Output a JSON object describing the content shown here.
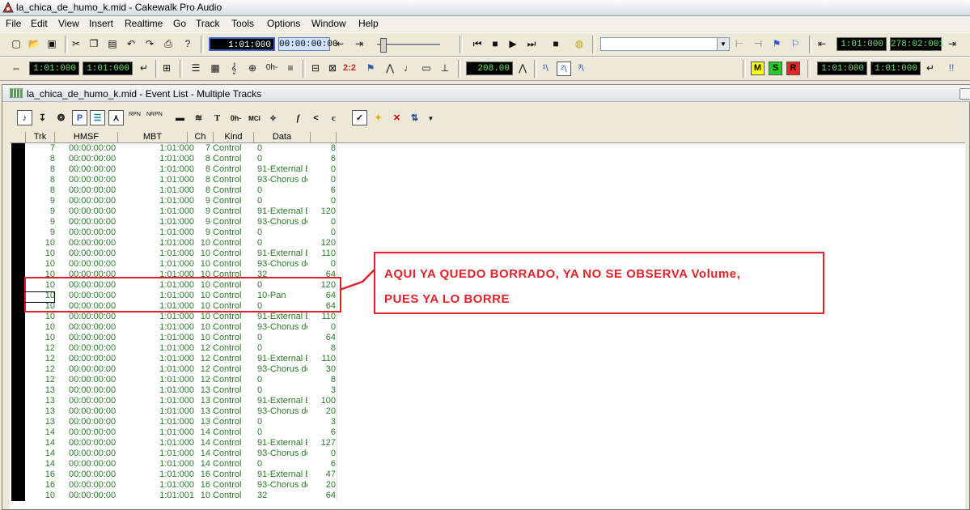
{
  "window": {
    "title": "la_chica_de_humo_k.mid - Cakewalk Pro Audio"
  },
  "menu": [
    "File",
    "Edit",
    "View",
    "Insert",
    "Realtime",
    "Go",
    "Track",
    "Tools",
    "Options",
    "Window",
    "Help"
  ],
  "toolbar1": {
    "now_time": "1:01:000",
    "smpte": "00:00:00:00",
    "from_time": "1:01:000",
    "thru_time": "278:02:001"
  },
  "toolbar2": {
    "from": "1:01:000",
    "thru": "1:01:000",
    "tempo": "208.00",
    "punch_in": "1:01:000",
    "punch_out": "1:01:000",
    "msr_m": "M",
    "msr_s": "S",
    "msr_r": "R",
    "time_sig": "0h-",
    "ratio": "2:2"
  },
  "event_list": {
    "title": "la_chica_de_humo_k.mid - Event List - Multiple Tracks",
    "toolbar": {
      "p": "P",
      "rpn": "RPN",
      "nrpn": "NRPN",
      "text": "T",
      "ch": "0h-",
      "mci": "MCI",
      "f": "f",
      "c": "c"
    },
    "columns": [
      "Trk",
      "HMSF",
      "MBT",
      "Ch",
      "Kind",
      "Data"
    ],
    "rows": [
      [
        "7",
        "00:00:00:00",
        "1:01:000",
        "7",
        "Control",
        "0",
        "8"
      ],
      [
        "8",
        "00:00:00:00",
        "1:01:000",
        "8",
        "Control",
        "0",
        "6"
      ],
      [
        "8",
        "00:00:00:00",
        "1:01:000",
        "8",
        "Control",
        "91-External E",
        "0"
      ],
      [
        "8",
        "00:00:00:00",
        "1:01:000",
        "8",
        "Control",
        "93-Chorus de",
        "0"
      ],
      [
        "8",
        "00:00:00:00",
        "1:01:000",
        "8",
        "Control",
        "0",
        "6"
      ],
      [
        "9",
        "00:00:00:00",
        "1:01:000",
        "9",
        "Control",
        "0",
        "0"
      ],
      [
        "9",
        "00:00:00:00",
        "1:01:000",
        "9",
        "Control",
        "91-External E",
        "120"
      ],
      [
        "9",
        "00:00:00:00",
        "1:01:000",
        "9",
        "Control",
        "93-Chorus de",
        "0"
      ],
      [
        "9",
        "00:00:00:00",
        "1:01:000",
        "9",
        "Control",
        "0",
        "0"
      ],
      [
        "10",
        "00:00:00:00",
        "1:01:000",
        "10",
        "Control",
        "0",
        "120"
      ],
      [
        "10",
        "00:00:00:00",
        "1:01:000",
        "10",
        "Control",
        "91-External E",
        "110"
      ],
      [
        "10",
        "00:00:00:00",
        "1:01:000",
        "10",
        "Control",
        "93-Chorus de",
        "0"
      ],
      [
        "10",
        "00:00:00:00",
        "1:01:000",
        "10",
        "Control",
        "32",
        "64"
      ],
      [
        "10",
        "00:00:00:00",
        "1:01:000",
        "10",
        "Control",
        "0",
        "120"
      ],
      [
        "10",
        "00:00:00:00",
        "1:01:000",
        "10",
        "Control",
        "10-Pan",
        "64"
      ],
      [
        "10",
        "00:00:00:00",
        "1:01:000",
        "10",
        "Control",
        "0",
        "64"
      ],
      [
        "10",
        "00:00:00:00",
        "1:01:000",
        "10",
        "Control",
        "91-External E",
        "110"
      ],
      [
        "10",
        "00:00:00:00",
        "1:01:000",
        "10",
        "Control",
        "93-Chorus de",
        "0"
      ],
      [
        "10",
        "00:00:00:00",
        "1:01:000",
        "10",
        "Control",
        "0",
        "64"
      ],
      [
        "12",
        "00:00:00:00",
        "1:01:000",
        "12",
        "Control",
        "0",
        "8"
      ],
      [
        "12",
        "00:00:00:00",
        "1:01:000",
        "12",
        "Control",
        "91-External E",
        "110"
      ],
      [
        "12",
        "00:00:00:00",
        "1:01:000",
        "12",
        "Control",
        "93-Chorus de",
        "30"
      ],
      [
        "12",
        "00:00:00:00",
        "1:01:000",
        "12",
        "Control",
        "0",
        "8"
      ],
      [
        "13",
        "00:00:00:00",
        "1:01:000",
        "13",
        "Control",
        "0",
        "3"
      ],
      [
        "13",
        "00:00:00:00",
        "1:01:000",
        "13",
        "Control",
        "91-External E",
        "100"
      ],
      [
        "13",
        "00:00:00:00",
        "1:01:000",
        "13",
        "Control",
        "93-Chorus de",
        "20"
      ],
      [
        "13",
        "00:00:00:00",
        "1:01:000",
        "13",
        "Control",
        "0",
        "3"
      ],
      [
        "14",
        "00:00:00:00",
        "1:01:000",
        "14",
        "Control",
        "0",
        "6"
      ],
      [
        "14",
        "00:00:00:00",
        "1:01:000",
        "14",
        "Control",
        "91-External E",
        "127"
      ],
      [
        "14",
        "00:00:00:00",
        "1:01:000",
        "14",
        "Control",
        "93-Chorus de",
        "0"
      ],
      [
        "14",
        "00:00:00:00",
        "1:01:000",
        "14",
        "Control",
        "0",
        "6"
      ],
      [
        "16",
        "00:00:00:00",
        "1:01:000",
        "16",
        "Control",
        "91-External E",
        "47"
      ],
      [
        "16",
        "00:00:00:00",
        "1:01:000",
        "16",
        "Control",
        "93-Chorus de",
        "20"
      ],
      [
        "10",
        "00:00:00:00",
        "1:01:001",
        "10",
        "Control",
        "32",
        "64"
      ]
    ]
  },
  "annotation": {
    "line1": "AQUI YA QUEDO BORRADO,  YA NO SE OBSERVA Volume,",
    "line2": "PUES YA LO BORRE",
    "color": "#e0232a"
  },
  "colors": {
    "row_text": "#2a7a2a",
    "lcd_text": "#6fe26f"
  }
}
